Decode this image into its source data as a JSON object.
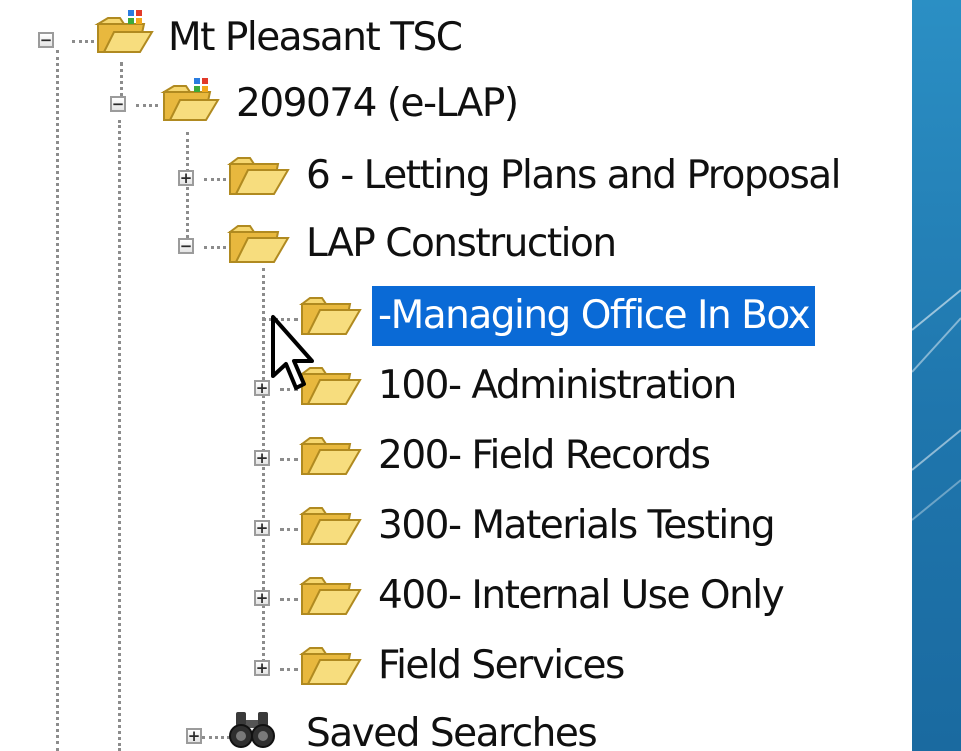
{
  "tree": {
    "root": {
      "label": "Mt Pleasant TSC",
      "expander": "−",
      "icon": "special-folder-icon",
      "children": [
        {
          "label": "209074 (e-LAP)",
          "expander": "−",
          "icon": "special-folder-icon",
          "children": [
            {
              "label": "6 - Letting Plans and Proposal",
              "expander": "+",
              "icon": "folder-icon"
            },
            {
              "label": "LAP Construction",
              "expander": "−",
              "icon": "folder-icon",
              "children": [
                {
                  "label": "-Managing Office In Box",
                  "selected": true,
                  "icon": "folder-icon"
                },
                {
                  "label": "100- Administration",
                  "expander": "+",
                  "icon": "folder-icon"
                },
                {
                  "label": "200- Field Records",
                  "expander": "+",
                  "icon": "folder-icon"
                },
                {
                  "label": "300- Materials Testing",
                  "expander": "+",
                  "icon": "folder-icon"
                },
                {
                  "label": "400- Internal Use Only",
                  "expander": "+",
                  "icon": "folder-icon"
                },
                {
                  "label": "Field Services",
                  "expander": "+",
                  "icon": "folder-icon"
                }
              ]
            }
          ]
        },
        {
          "label": "Saved Searches",
          "expander": "+",
          "icon": "binoculars-icon"
        }
      ]
    }
  },
  "colors": {
    "selection": "#0a6ad6",
    "slide_background": "#1f76ad",
    "folder": "#f2cf55"
  },
  "cursor": "arrow-cursor-icon"
}
